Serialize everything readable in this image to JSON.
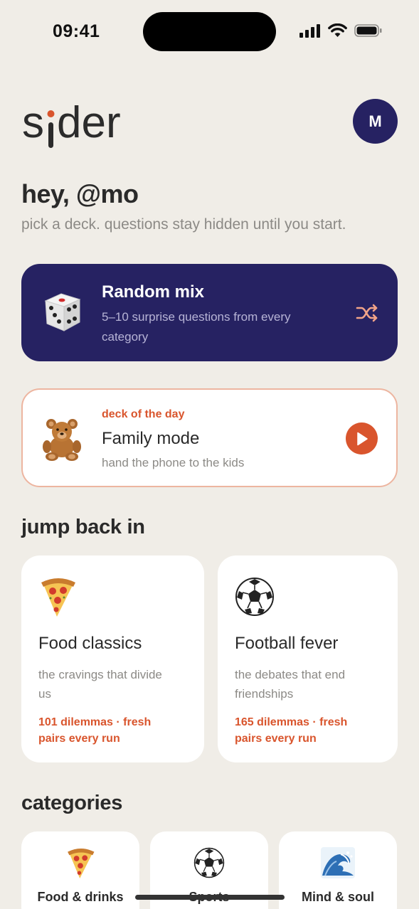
{
  "status_bar": {
    "time": "09:41"
  },
  "header": {
    "logo_text": "sider",
    "avatar_initial": "M"
  },
  "greeting": {
    "title": "hey, @mo",
    "subtitle": "pick a deck. questions stay hidden until you start."
  },
  "random_mix": {
    "title": "Random mix",
    "description": "5–10 surprise questions from every category",
    "icon": "dice-icon",
    "action_icon": "shuffle-icon"
  },
  "deck_of_day": {
    "label": "deck of the day",
    "title": "Family mode",
    "description": "hand the phone to the kids",
    "icon": "teddy-bear-icon",
    "action_icon": "play-icon"
  },
  "jump_back_in": {
    "title": "jump back in",
    "cards": [
      {
        "icon": "pizza-icon",
        "title": "Food classics",
        "description": "the cravings that divide us",
        "meta": "101 dilemmas · fresh pairs every run"
      },
      {
        "icon": "soccer-ball-icon",
        "title": "Football fever",
        "description": "the debates that end friendships",
        "meta": "165 dilemmas · fresh pairs every run"
      }
    ]
  },
  "categories": {
    "title": "categories",
    "items": [
      {
        "icon": "pizza-icon",
        "label": "Food & drinks"
      },
      {
        "icon": "soccer-ball-icon",
        "label": "Sports"
      },
      {
        "icon": "wave-icon",
        "label": "Mind & soul"
      }
    ]
  },
  "colors": {
    "background": "#F0EDE7",
    "navy": "#262262",
    "accent": "#D9552D",
    "card": "#FFFFFF",
    "muted_text": "#8C8A86"
  }
}
